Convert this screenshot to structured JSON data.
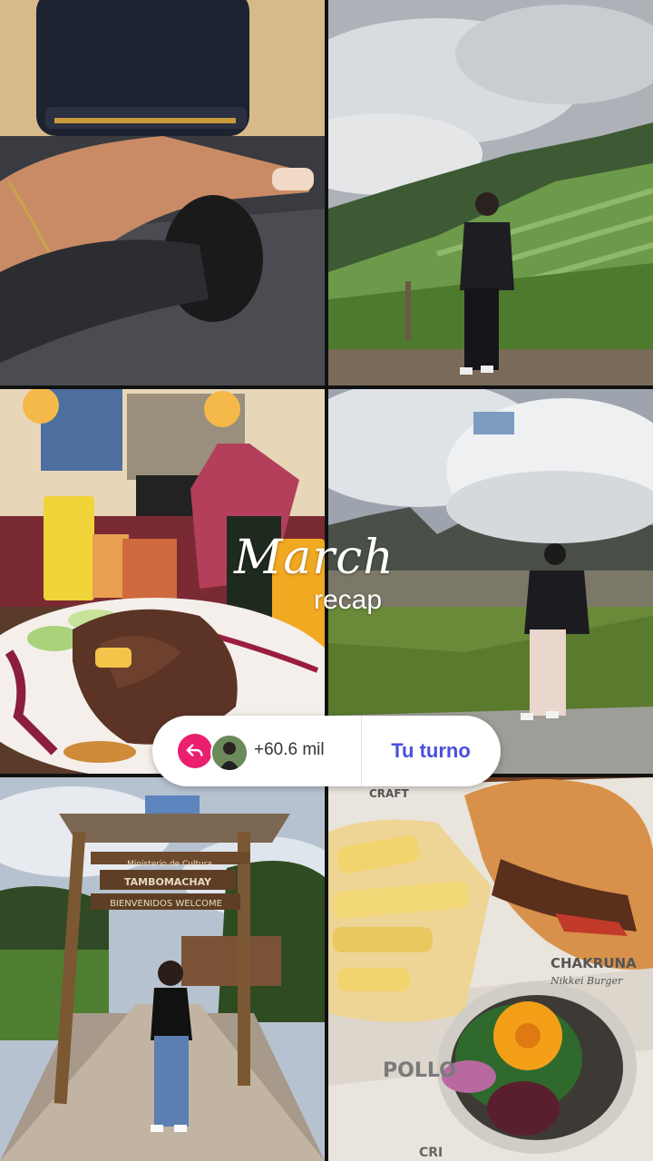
{
  "story": {
    "title_script": "March",
    "title_sub": "recap"
  },
  "sticker": {
    "icon": "reply-arrow-icon",
    "count": "+60.6 mil",
    "cta": "Tu turno",
    "accent": "#ea1f6e",
    "cta_color": "#4a4fdc"
  },
  "photos": {
    "sign_line1": "Ministerio de Cultura",
    "sign_line2": "TAMBOMACHAY",
    "sign_line3": "BIENVENIDOS WELCOME",
    "paper_brand": "CHAKRUNA",
    "paper_sub": "Nikkei Burger",
    "paper_word": "POLLO",
    "paper_top": "CRAFT",
    "paper_bottom": "CRI"
  }
}
